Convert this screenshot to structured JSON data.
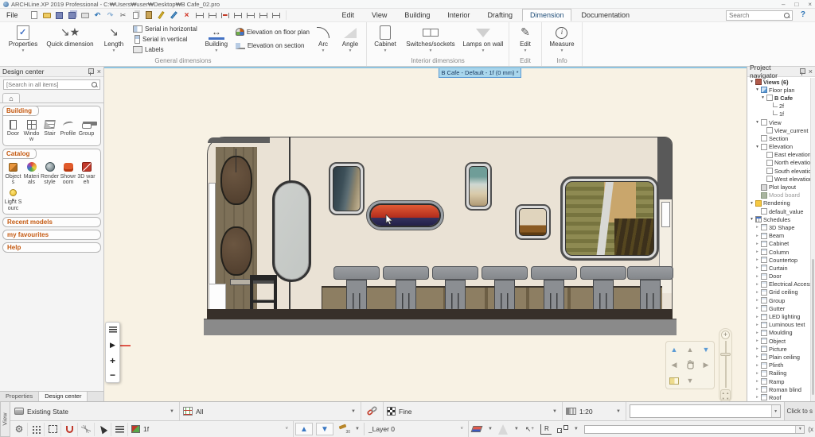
{
  "colors": {
    "accent_blue": "#5b9bd5",
    "doc_tab_fill": "#a9d6ec",
    "canvas_bg": "#f8f2e4",
    "wall_beige": "#eae2d5",
    "wood_brown": "#7d7058",
    "sign_red": "#c23b28",
    "sign_navy": "#2c2a52",
    "group_header_orange": "#c55a11"
  },
  "window": {
    "title": "ARCHLine.XP 2019  Professional - C:₩Users₩user₩Desktop₩B Cafe_02.pro",
    "minimize": "–",
    "maximize": "□",
    "close": "×"
  },
  "menubar": {
    "file": "File",
    "quick_icons": [
      {
        "n": "new-document-icon",
        "g": ""
      },
      {
        "n": "open-folder-icon",
        "g": ""
      },
      {
        "n": "save-icon",
        "g": ""
      },
      {
        "n": "save-all-icon",
        "g": ""
      },
      {
        "n": "print-icon",
        "g": ""
      },
      {
        "n": "undo-icon",
        "g": "↶"
      },
      {
        "n": "redo-icon",
        "g": "↷"
      },
      {
        "n": "cut-icon",
        "g": "✂"
      },
      {
        "n": "copy-icon",
        "g": ""
      },
      {
        "n": "paste-icon",
        "g": ""
      },
      {
        "n": "format-brush-icon",
        "g": ""
      },
      {
        "n": "edit-pen-icon",
        "g": ""
      },
      {
        "n": "delete-icon",
        "g": "×"
      },
      {
        "n": "dim-serial-icon dimg",
        "g": ""
      },
      {
        "n": "dim-corner-icon dimg",
        "g": ""
      },
      {
        "n": "dim-red-icon dimg",
        "g": ""
      },
      {
        "n": "dim-offset-icon dimg",
        "g": ""
      },
      {
        "n": "dim-angle-icon dimg",
        "g": ""
      },
      {
        "n": "dim-point-icon dimg",
        "g": ""
      },
      {
        "n": "dim-style-icon dimg",
        "g": ""
      }
    ],
    "tabs": [
      "Edit",
      "View",
      "Building",
      "Interior",
      "Drafting",
      "Dimension",
      "Documentation"
    ],
    "active_tab": "Dimension",
    "search_placeholder": "Search",
    "help": "?"
  },
  "ribbon": {
    "properties": "Properties",
    "quick_dimension": "Quick dimension",
    "length": "Length",
    "serial_items": [
      {
        "t": "Serial in horizontal",
        "i": "ser-h"
      },
      {
        "t": "Serial in vertical",
        "i": "ser-v"
      },
      {
        "t": "Labels",
        "i": "ser-lab"
      }
    ],
    "building": "Building",
    "elevation_items": [
      {
        "t": "Elevation on floor plan",
        "i": "elv-fp"
      },
      {
        "t": "Elevation on section",
        "i": "elv-sec"
      }
    ],
    "arc": "Arc",
    "angle": "Angle",
    "general_group": "General dimensions",
    "cabinet": "Cabinet",
    "switches": "Switches/sockets",
    "lamps": "Lamps on wall",
    "interior_group": "Interior dimensions",
    "edit": "Edit",
    "edit_group": "Edit",
    "measure": "Measure",
    "info_group": "Info"
  },
  "canvas": {
    "doc_tab": "B Cafe - Default - 1f (0 mm) *"
  },
  "design_center": {
    "title": "Design center",
    "search_placeholder": "[Search in all items]",
    "home_icon": "⌂",
    "building_group": "Building",
    "building_items": [
      {
        "t": "Door",
        "i": "dc-door"
      },
      {
        "t": "Window",
        "i": "dc-window"
      },
      {
        "t": "Stair",
        "i": "dc-stair"
      },
      {
        "t": "Profile",
        "i": "dc-profile"
      },
      {
        "t": "Group",
        "i": "dc-group-ic"
      }
    ],
    "catalog_group": "Catalog",
    "catalog_items": [
      {
        "t": "Objects",
        "i": "dc-objects"
      },
      {
        "t": "Materials",
        "i": "dc-materials"
      },
      {
        "t": "Render style",
        "i": "dc-render"
      },
      {
        "t": "Showroom",
        "i": "dc-showroom"
      },
      {
        "t": "3D wareh",
        "i": "dc-3dw"
      },
      {
        "t": "Light Sourc",
        "i": "dc-light"
      }
    ],
    "collapsed_groups": [
      "Recent models",
      "my favourites",
      "Help"
    ],
    "bottom_tabs": [
      "Properties",
      "Design center"
    ],
    "active_bottom_tab": "Design center"
  },
  "project_navigator": {
    "title": "Project navigator",
    "items": [
      {
        "l": "l0",
        "a": "e",
        "i": "ic-views",
        "t": "Views (6)",
        "cls": "b"
      },
      {
        "l": "l1",
        "a": "e",
        "i": "ic-fp",
        "t": "Floor plan",
        "cls": ""
      },
      {
        "l": "l2",
        "a": "e",
        "i": "ic-doc",
        "t": "B Cafe",
        "cls": "b"
      },
      {
        "l": "l3",
        "a": "",
        "i": "ic-line",
        "t": "2f",
        "cls": ""
      },
      {
        "l": "l3",
        "a": "",
        "i": "ic-line",
        "t": "1f",
        "cls": ""
      },
      {
        "l": "l1",
        "a": "e",
        "i": "ic-doc",
        "t": "View",
        "cls": ""
      },
      {
        "l": "l2",
        "a": "",
        "i": "ic-doc",
        "t": "View_current",
        "cls": ""
      },
      {
        "l": "l1",
        "a": "",
        "i": "ic-doc",
        "t": "Section",
        "cls": ""
      },
      {
        "l": "l1",
        "a": "e",
        "i": "ic-doc",
        "t": "Elevation",
        "cls": ""
      },
      {
        "l": "l2",
        "a": "",
        "i": "ic-doc",
        "t": "East elevation",
        "cls": ""
      },
      {
        "l": "l2",
        "a": "",
        "i": "ic-doc",
        "t": "North elevation",
        "cls": ""
      },
      {
        "l": "l2",
        "a": "",
        "i": "ic-doc",
        "t": "South elevation",
        "cls": ""
      },
      {
        "l": "l2",
        "a": "",
        "i": "ic-doc",
        "t": "West elevation",
        "cls": ""
      },
      {
        "l": "l1",
        "a": "",
        "i": "ic-plot",
        "t": "Plot layout",
        "cls": ""
      },
      {
        "l": "l1",
        "a": "",
        "i": "ic-mood",
        "t": "Mood board",
        "cls": "g"
      },
      {
        "l": "l0",
        "a": "e",
        "i": "ic-folder",
        "t": "Rendering",
        "cls": ""
      },
      {
        "l": "l1",
        "a": "",
        "i": "ic-doc",
        "t": "default_value",
        "cls": ""
      },
      {
        "l": "l0",
        "a": "e",
        "i": "ic-sched",
        "t": "Schedules",
        "cls": ""
      },
      {
        "l": "l1",
        "a": "c",
        "i": "ic-schd",
        "t": "3D Shape",
        "cls": ""
      },
      {
        "l": "l1",
        "a": "c",
        "i": "ic-schd",
        "t": "Beam",
        "cls": ""
      },
      {
        "l": "l1",
        "a": "c",
        "i": "ic-schd",
        "t": "Cabinet",
        "cls": ""
      },
      {
        "l": "l1",
        "a": "c",
        "i": "ic-schd",
        "t": "Column",
        "cls": ""
      },
      {
        "l": "l1",
        "a": "c",
        "i": "ic-schd",
        "t": "Countertop",
        "cls": ""
      },
      {
        "l": "l1",
        "a": "c",
        "i": "ic-schd",
        "t": "Curtain",
        "cls": ""
      },
      {
        "l": "l1",
        "a": "c",
        "i": "ic-schd",
        "t": "Door",
        "cls": ""
      },
      {
        "l": "l1",
        "a": "c",
        "i": "ic-schd",
        "t": "Electrical Access",
        "cls": ""
      },
      {
        "l": "l1",
        "a": "c",
        "i": "ic-schd",
        "t": "Grid ceiling",
        "cls": ""
      },
      {
        "l": "l1",
        "a": "c",
        "i": "ic-schd",
        "t": "Group",
        "cls": ""
      },
      {
        "l": "l1",
        "a": "c",
        "i": "ic-schd",
        "t": "Gutter",
        "cls": ""
      },
      {
        "l": "l1",
        "a": "c",
        "i": "ic-schd",
        "t": "LED lighting",
        "cls": ""
      },
      {
        "l": "l1",
        "a": "c",
        "i": "ic-schd",
        "t": "Luminous text",
        "cls": ""
      },
      {
        "l": "l1",
        "a": "c",
        "i": "ic-schd",
        "t": "Moulding",
        "cls": ""
      },
      {
        "l": "l1",
        "a": "c",
        "i": "ic-schd",
        "t": "Object",
        "cls": ""
      },
      {
        "l": "l1",
        "a": "c",
        "i": "ic-schd",
        "t": "Picture",
        "cls": ""
      },
      {
        "l": "l1",
        "a": "c",
        "i": "ic-schd",
        "t": "Plain ceiling",
        "cls": ""
      },
      {
        "l": "l1",
        "a": "c",
        "i": "ic-schd",
        "t": "Plinth",
        "cls": ""
      },
      {
        "l": "l1",
        "a": "c",
        "i": "ic-schd",
        "t": "Railing",
        "cls": ""
      },
      {
        "l": "l1",
        "a": "c",
        "i": "ic-schd",
        "t": "Ramp",
        "cls": ""
      },
      {
        "l": "l1",
        "a": "c",
        "i": "ic-schd",
        "t": "Roman blind",
        "cls": ""
      },
      {
        "l": "l1",
        "a": "c",
        "i": "ic-schd",
        "t": "Roof",
        "cls": ""
      }
    ]
  },
  "status1": {
    "view_tab": "View",
    "state": "Existing State",
    "filter": "All",
    "quality": "Fine",
    "scale": "1:20",
    "input_value": "",
    "hint": "Click to s"
  },
  "status2": {
    "icons": [
      {
        "n": "settings-gear-icon",
        "g": "⚙"
      },
      {
        "n": "grid-icon",
        "g": ""
      },
      {
        "n": "selection-frame-icon",
        "g": ""
      },
      {
        "n": "magnet-icon",
        "g": ""
      },
      {
        "n": "rays-icon",
        "g": ""
      },
      {
        "n": "select-cursor-icon",
        "g": ""
      },
      {
        "n": "list-icon",
        "g": ""
      }
    ],
    "level": "1f",
    "layer": "_Layer 0",
    "input_value": "",
    "hint": "(x"
  }
}
